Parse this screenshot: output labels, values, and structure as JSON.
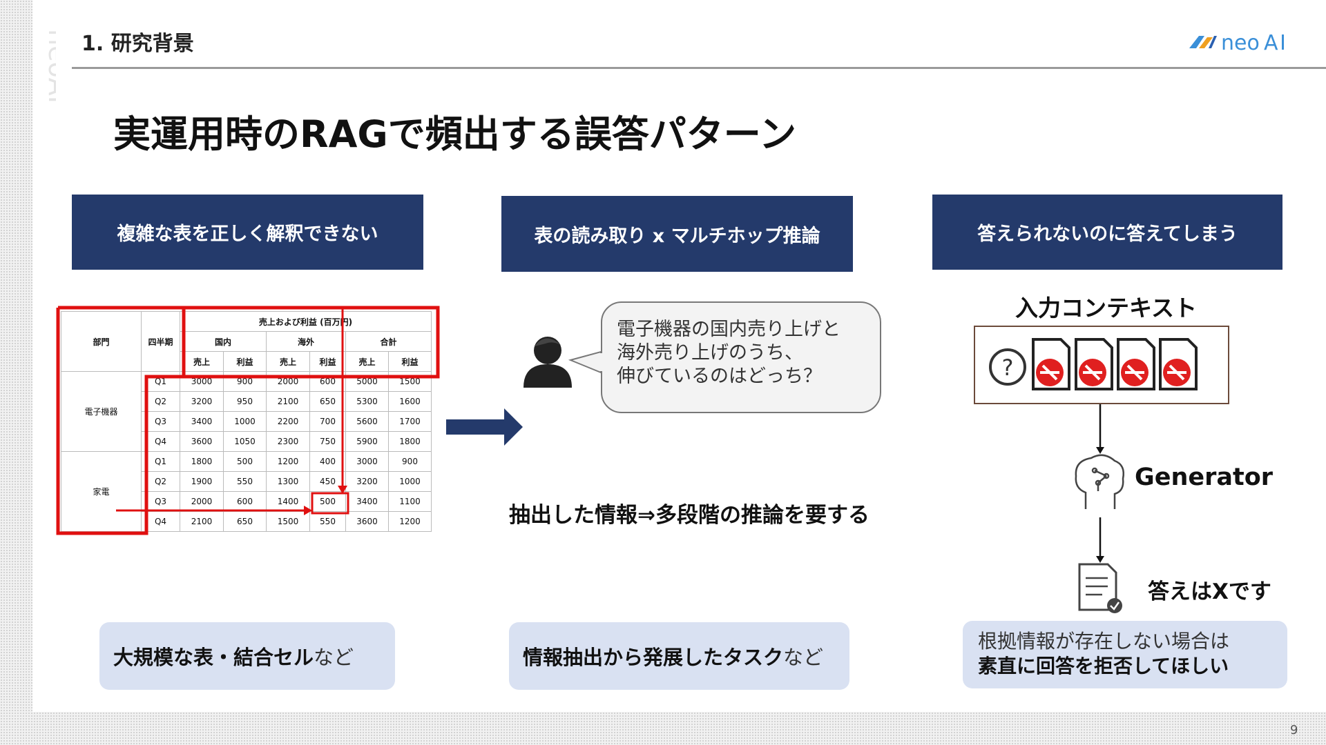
{
  "header": {
    "section": "1. 研究背景",
    "logo_text": "neoAI"
  },
  "title": "実運用時のRAGで頻出する誤答パターン",
  "columns": [
    {
      "header": "複雑な表を正しく解釈できない",
      "pill_bold": "大規模な表・結合セル",
      "pill_tail": "など"
    },
    {
      "header": "表の読み取り x マルチホップ推論",
      "pill_bold": "情報抽出から発展したタスク",
      "pill_tail": "など"
    },
    {
      "header": "答えられないのに答えてしまう",
      "pill_line1": "根拠情報が存在しない場合は",
      "pill_line2": "素直に回答を拒否してほしい"
    }
  ],
  "table": {
    "group_header": "売上および利益 (百万円)",
    "dept_header": "部門",
    "quarter_header": "四半期",
    "regions": [
      "国内",
      "海外",
      "合計"
    ],
    "sub_headers": [
      "売上",
      "利益",
      "売上",
      "利益",
      "売上",
      "利益"
    ],
    "groups": [
      {
        "name": "電子機器",
        "rows": [
          {
            "q": "Q1",
            "v": [
              "3000",
              "900",
              "2000",
              "600",
              "5000",
              "1500"
            ]
          },
          {
            "q": "Q2",
            "v": [
              "3200",
              "950",
              "2100",
              "650",
              "5300",
              "1600"
            ]
          },
          {
            "q": "Q3",
            "v": [
              "3400",
              "1000",
              "2200",
              "700",
              "5600",
              "1700"
            ]
          },
          {
            "q": "Q4",
            "v": [
              "3600",
              "1050",
              "2300",
              "750",
              "5900",
              "1800"
            ]
          }
        ]
      },
      {
        "name": "家電",
        "rows": [
          {
            "q": "Q1",
            "v": [
              "1800",
              "500",
              "1200",
              "400",
              "3000",
              "900"
            ]
          },
          {
            "q": "Q2",
            "v": [
              "1900",
              "550",
              "1300",
              "450",
              "3200",
              "1000"
            ]
          },
          {
            "q": "Q3",
            "v": [
              "2000",
              "600",
              "1400",
              "500",
              "3400",
              "1100"
            ]
          },
          {
            "q": "Q4",
            "v": [
              "2100",
              "650",
              "1500",
              "550",
              "3600",
              "1200"
            ]
          }
        ]
      }
    ]
  },
  "question": {
    "line1": "電子機器の国内売り上げと",
    "line2": "海外売り上げのうち、",
    "line3": "伸びているのはどっち？"
  },
  "mid_text": "抽出した情報⇒多段階の推論を要する",
  "context": {
    "title": "入力コンテキスト",
    "generator": "Generator",
    "answer": "答えはXです"
  },
  "page_number": "9",
  "colors": {
    "header_bg": "#243a6b",
    "pill_bg": "#d9e1f2",
    "highlight_red": "#e01010",
    "arrow_navy": "#243a6b"
  },
  "icons": [
    "person-icon",
    "question-icon",
    "document-blocked-icon",
    "brain-icon",
    "document-check-icon",
    "arrow-right-icon"
  ]
}
